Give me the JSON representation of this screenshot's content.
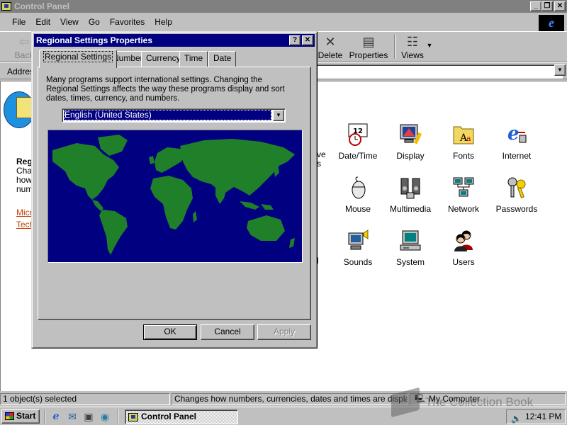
{
  "main_window": {
    "title": "Control Panel",
    "controls": {
      "minimize": "_",
      "maximize": "❐",
      "close": "✕"
    }
  },
  "menu": [
    "File",
    "Edit",
    "View",
    "Go",
    "Favorites",
    "Help"
  ],
  "toolbar": {
    "back_label": "Back",
    "delete_label": "Delete",
    "properties_label": "Properties",
    "views_label": "Views"
  },
  "address": {
    "label": "Address",
    "value": ""
  },
  "sidebar": {
    "title": "Regional Settings",
    "description": "Changes how numbers, currencies, dates and times are displayed.",
    "links": [
      "Microsoft Home",
      "Technical Support"
    ]
  },
  "items": [
    {
      "label": "Date/Time",
      "icon": "calendar-clock-icon"
    },
    {
      "label": "Display",
      "icon": "monitor-icon"
    },
    {
      "label": "Fonts",
      "icon": "fonts-folder-icon"
    },
    {
      "label": "Internet",
      "icon": "internet-icon"
    },
    {
      "label": "Mouse",
      "icon": "mouse-icon"
    },
    {
      "label": "Multimedia",
      "icon": "multimedia-icon"
    },
    {
      "label": "Network",
      "icon": "network-icon"
    },
    {
      "label": "Passwords",
      "icon": "keys-icon"
    },
    {
      "label": "Sounds",
      "icon": "sounds-icon"
    },
    {
      "label": "System",
      "icon": "computer-icon"
    },
    {
      "label": "Users",
      "icon": "users-icon"
    }
  ],
  "partial_labels": [
    "ve",
    "s",
    "l"
  ],
  "status": {
    "selection": "1 object(s) selected",
    "info": "Changes how numbers, currencies, dates and times are displayed.",
    "location": "My Computer"
  },
  "taskbar": {
    "start": "Start",
    "task": "Control Panel",
    "clock": "12:41 PM"
  },
  "watermark": "The Collection Book",
  "dialog": {
    "title": "Regional Settings Properties",
    "help": "?",
    "close": "✕",
    "tabs": [
      "Regional Settings",
      "Number",
      "Currency",
      "Time",
      "Date"
    ],
    "description": "Many programs support international settings. Changing the Regional Settings affects the way these programs display and sort dates, times, currency, and numbers.",
    "locale": "English (United States)",
    "buttons": {
      "ok": "OK",
      "cancel": "Cancel",
      "apply": "Apply"
    }
  },
  "colors": {
    "dialog_title_bar": "#000080",
    "map_ocean": "#000080",
    "map_land": "#20802a",
    "inactive_title_bar": "#808080",
    "link": "#c04000"
  }
}
